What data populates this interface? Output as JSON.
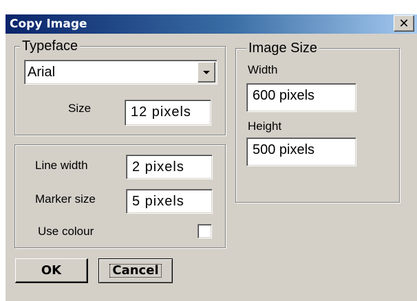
{
  "window": {
    "title": "Copy Image",
    "close_glyph": "✕"
  },
  "typeface": {
    "legend": "Typeface",
    "font_value": "Arial",
    "size_label": "Size",
    "size_value": "12  pixels"
  },
  "lines": {
    "line_width_label": "Line width",
    "line_width_value": "2  pixels",
    "marker_size_label": "Marker size",
    "marker_size_value": "5  pixels",
    "use_colour_label": "Use colour",
    "use_colour_checked": false
  },
  "image_size": {
    "legend": "Image Size",
    "width_label": "Width",
    "width_value": "600 pixels",
    "height_label": "Height",
    "height_value": "500 pixels"
  },
  "buttons": {
    "ok": "OK",
    "cancel": "Cancel"
  },
  "icons": {
    "close": "close-icon",
    "dropdown": "chevron-down-icon"
  }
}
